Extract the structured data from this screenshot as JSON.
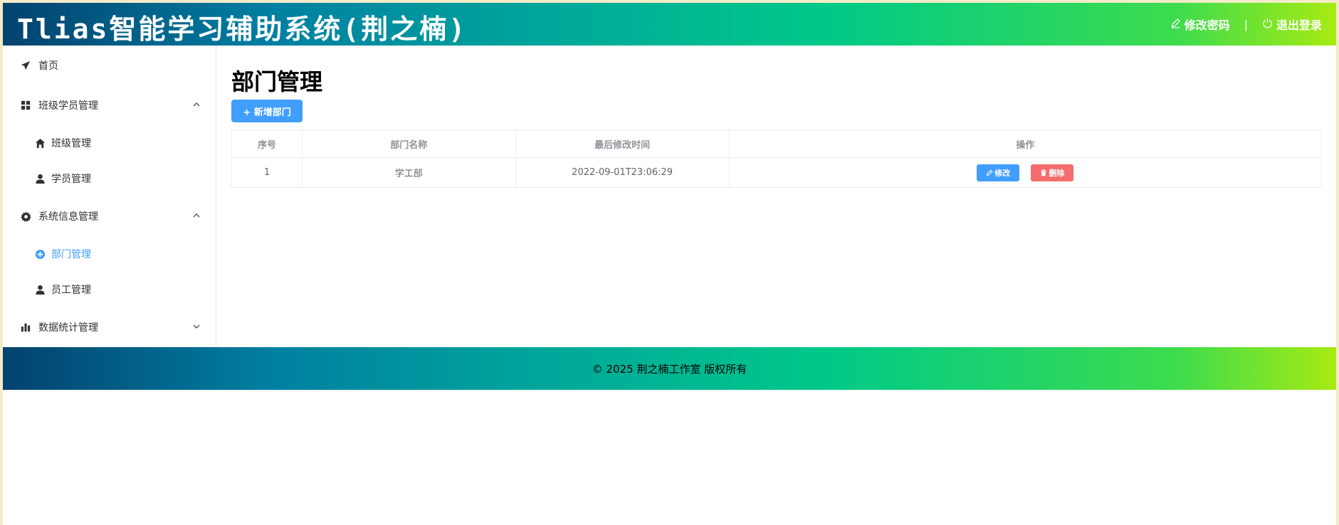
{
  "header": {
    "title": "Tlias智能学习辅助系统(荆之楠)",
    "change_password": "修改密码",
    "separator": "|",
    "logout": "退出登录"
  },
  "sidebar": {
    "home": "首页",
    "group_class_student": "班级学员管理",
    "class_manage": "班级管理",
    "student_manage": "学员管理",
    "group_system": "系统信息管理",
    "dept_manage": "部门管理",
    "emp_manage": "员工管理",
    "group_stats": "数据统计管理"
  },
  "main": {
    "page_title": "部门管理",
    "add_button": "+ 新增部门",
    "table": {
      "headers": [
        "序号",
        "部门名称",
        "最后修改时间",
        "操作"
      ],
      "rows": [
        {
          "index": "1",
          "name": "学工部",
          "updated": "2022-09-01T23:06:29"
        }
      ],
      "edit_label": "修改",
      "delete_label": "删除"
    }
  },
  "footer": {
    "text": "© 2025 荆之楠工作室 版权所有"
  },
  "colors": {
    "accent": "#409eff",
    "danger": "#f56c6c",
    "gradient_start": "#03426f",
    "gradient_end": "#a7ea12"
  }
}
